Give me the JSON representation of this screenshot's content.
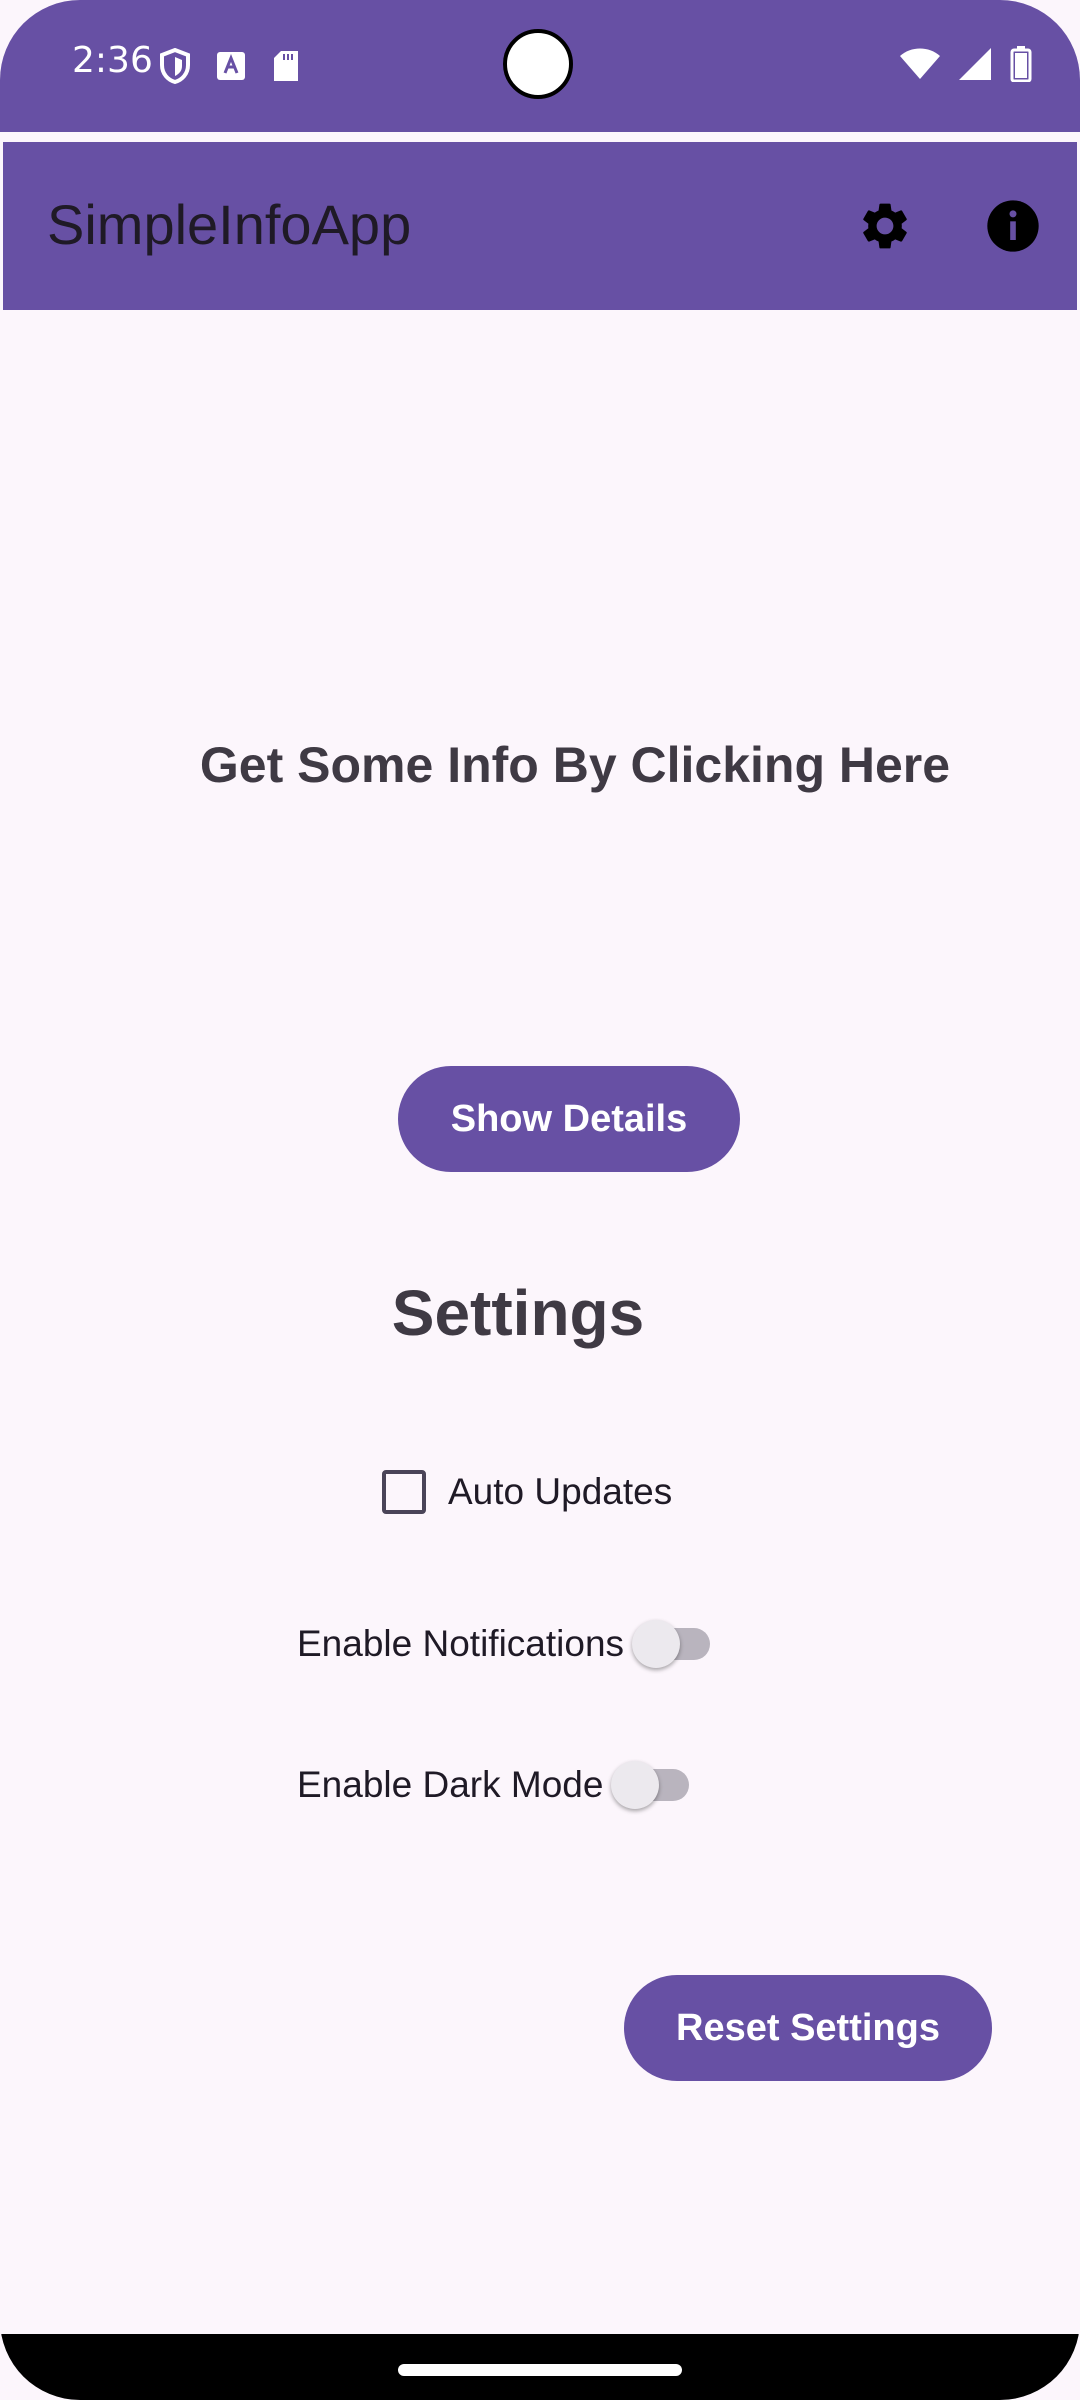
{
  "status_bar": {
    "time": "2:36",
    "left_icons": [
      "shield-icon",
      "a-badge-icon",
      "sd-card-icon"
    ],
    "right_icons": [
      "wifi-icon",
      "signal-icon",
      "battery-icon"
    ]
  },
  "app_bar": {
    "title": "SimpleInfoApp",
    "actions": [
      "settings-icon",
      "info-icon"
    ]
  },
  "main": {
    "info_heading": "Get Some Info By Clicking Here",
    "show_details_label": "Show Details",
    "settings_heading": "Settings",
    "auto_updates": {
      "label": "Auto Updates",
      "checked": false
    },
    "notifications": {
      "label": "Enable Notifications",
      "on": false
    },
    "dark_mode": {
      "label": "Enable Dark Mode",
      "on": false
    },
    "reset_label": "Reset Settings"
  },
  "colors": {
    "primary": "#6750A4",
    "background": "#FCF6FC",
    "on_surface": "#3F3A44"
  }
}
